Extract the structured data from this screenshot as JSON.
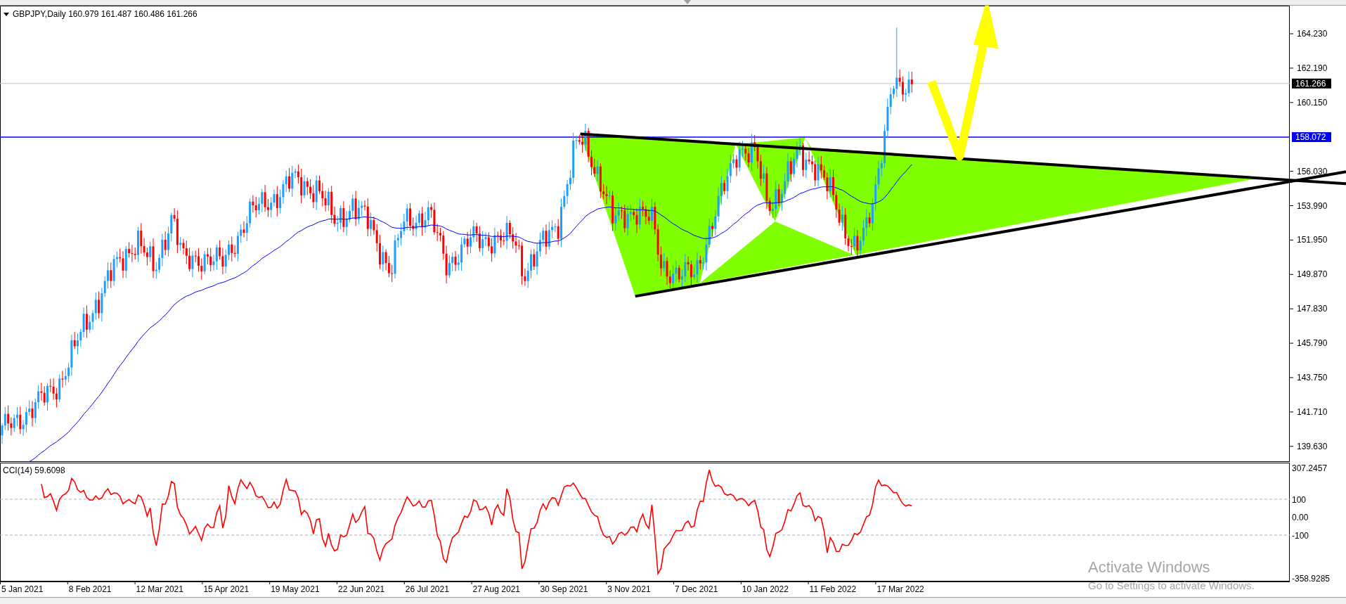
{
  "chart": {
    "header": {
      "text": "GBPJPY,Daily 160.979 161.487 160.486 161.266"
    },
    "price_axis": [
      "164.230",
      "162.190",
      "160.150",
      "156.030",
      "153.990",
      "151.950",
      "149.870",
      "147.830",
      "145.790",
      "143.750",
      "141.710",
      "139.630"
    ],
    "price_tags": [
      {
        "text": "161.266",
        "kind": "bid",
        "color": "#000000"
      },
      {
        "text": "158.072",
        "kind": "hline",
        "color": "#0000ff"
      }
    ],
    "indicator": {
      "label": "CCI(14) 59.6098",
      "axis": [
        "307.2457",
        "100",
        "0.00",
        "-100",
        "-358.9285"
      ]
    },
    "time_axis": [
      "5 Jan 2021",
      "8 Feb 2021",
      "12 Mar 2021",
      "15 Apr 2021",
      "19 May 2021",
      "22 Jun 2021",
      "26 Jul 2021",
      "27 Aug 2021",
      "30 Sep 2021",
      "3 Nov 2021",
      "7 Dec 2021",
      "10 Jan 2022",
      "11 Feb 2022",
      "17 Mar 2022"
    ]
  },
  "os_notice": {
    "title": "Activate Windows",
    "subtitle": "Go to Settings to activate Windows."
  }
}
